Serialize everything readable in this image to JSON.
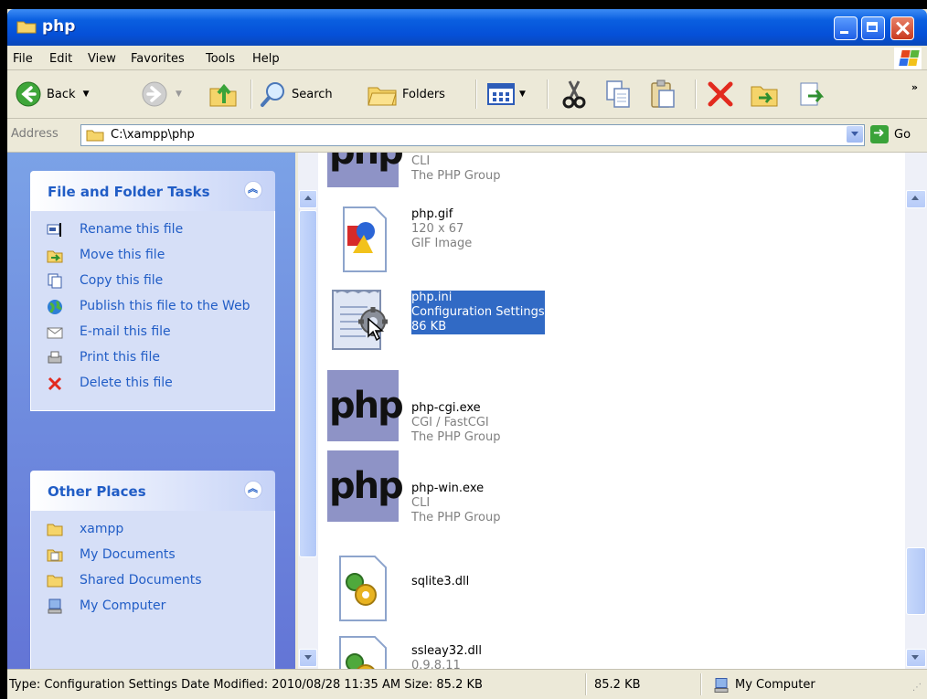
{
  "window": {
    "title": "php"
  },
  "menu": [
    "File",
    "Edit",
    "View",
    "Favorites",
    "Tools",
    "Help"
  ],
  "toolbar": {
    "back": "Back",
    "search": "Search",
    "folders": "Folders"
  },
  "address": {
    "label": "Address",
    "path": "C:\\xampp\\php",
    "go": "Go"
  },
  "tasks": {
    "title": "File and Folder Tasks",
    "items": [
      "Rename this file",
      "Move this file",
      "Copy this file",
      "Publish this file to the Web",
      "E-mail this file",
      "Print this file",
      "Delete this file"
    ]
  },
  "places": {
    "title": "Other Places",
    "items": [
      "xampp",
      "My Documents",
      "Shared Documents",
      "My Computer"
    ]
  },
  "files": [
    {
      "name": "",
      "line2": "CLI",
      "line3": "The PHP Group",
      "icon": "php-logo"
    },
    {
      "name": "php.gif",
      "line2": "120 x 67",
      "line3": "GIF Image",
      "icon": "gif-image-icon"
    },
    {
      "name": "php.ini",
      "line2": "Configuration Settings",
      "line3": "86 KB",
      "icon": "config-settings-icon",
      "selected": true
    },
    {
      "name": "php-cgi.exe",
      "line2": "CGI / FastCGI",
      "line3": "The PHP Group",
      "icon": "php-logo"
    },
    {
      "name": "php-win.exe",
      "line2": "CLI",
      "line3": "The PHP Group",
      "icon": "php-logo"
    },
    {
      "name": "sqlite3.dll",
      "line2": "",
      "line3": "",
      "icon": "dll-icon"
    },
    {
      "name": "ssleay32.dll",
      "line2": "0.9.8.11",
      "line3": "",
      "icon": "dll-icon"
    }
  ],
  "status": {
    "info": "Type: Configuration Settings Date Modified: 2010/08/28 11:35 AM Size: 85.2 KB",
    "size": "85.2 KB",
    "zone": "My Computer"
  },
  "colors": {
    "title_bar": "#0550d8",
    "task_pane": "#6375d6",
    "selection": "#316ac5",
    "link": "#215dc6"
  }
}
